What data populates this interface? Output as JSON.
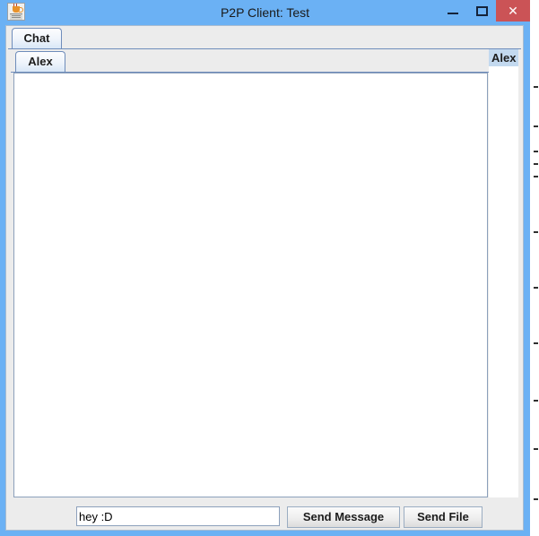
{
  "window": {
    "title": "P2P Client: Test",
    "app_icon": "java-coffee-cup-icon",
    "controls": {
      "minimize_label": "–",
      "maximize_label": "❐",
      "close_label": "✕"
    },
    "colors": {
      "titlebar": "#6bb1f4",
      "close_button": "#cb5356",
      "client_background": "#ececec",
      "selection": "#c3d9ef",
      "border": "#6f8dbb"
    }
  },
  "outer_tabs": [
    {
      "label": "Chat",
      "selected": true
    }
  ],
  "inner_tabs": [
    {
      "label": "Alex",
      "selected": true
    }
  ],
  "chat": {
    "transcript": ""
  },
  "user_list": {
    "items": [
      {
        "label": "Alex",
        "selected": true
      }
    ]
  },
  "composer": {
    "input_value": "hey :D",
    "input_placeholder": "",
    "send_message_label": "Send Message",
    "send_file_label": "Send File"
  }
}
